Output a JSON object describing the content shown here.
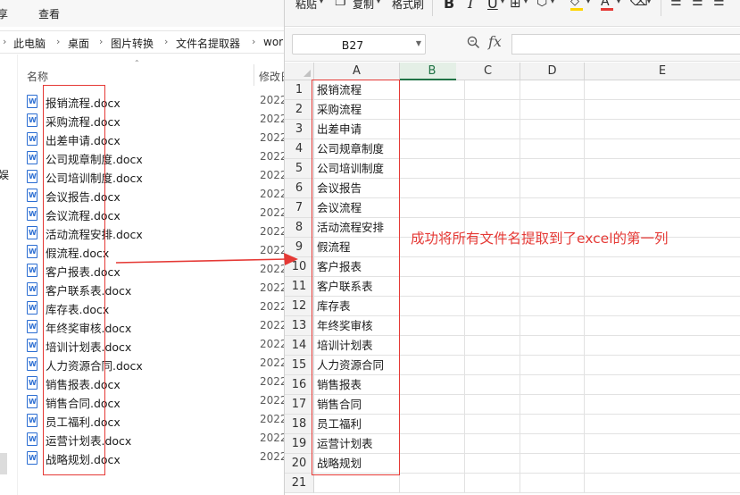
{
  "explorer": {
    "menu": [
      "享",
      "查看"
    ],
    "breadcrumb": [
      "此电脑",
      "桌面",
      "图片转换",
      "文件名提取器",
      "wor"
    ],
    "left_pane_text": "娱",
    "columns": {
      "name": "名称",
      "date": "修改日"
    },
    "files": [
      {
        "name": "报销流程.docx",
        "date": "2022"
      },
      {
        "name": "采购流程.docx",
        "date": "2022"
      },
      {
        "name": "出差申请.docx",
        "date": "2022"
      },
      {
        "name": "公司规章制度.docx",
        "date": "2022"
      },
      {
        "name": "公司培训制度.docx",
        "date": "2022"
      },
      {
        "name": "会议报告.docx",
        "date": "2022"
      },
      {
        "name": "会议流程.docx",
        "date": "2022"
      },
      {
        "name": "活动流程安排.docx",
        "date": "2022"
      },
      {
        "name": "假流程.docx",
        "date": "2022"
      },
      {
        "name": "客户报表.docx",
        "date": "2022"
      },
      {
        "name": "客户联系表.docx",
        "date": "2022"
      },
      {
        "name": "库存表.docx",
        "date": "2022"
      },
      {
        "name": "年终奖审核.docx",
        "date": "2022"
      },
      {
        "name": "培训计划表.docx",
        "date": "2022"
      },
      {
        "name": "人力资源合同.docx",
        "date": "2022"
      },
      {
        "name": "销售报表.docx",
        "date": "2022"
      },
      {
        "name": "销售合同.docx",
        "date": "2022"
      },
      {
        "name": "员工福利.docx",
        "date": "2022"
      },
      {
        "name": "运营计划表.docx",
        "date": "2022"
      },
      {
        "name": "战略规划.docx",
        "date": "2022"
      }
    ],
    "file_icon": "word-document-icon"
  },
  "ribbon": {
    "paste": "粘贴",
    "copy": "复制",
    "format_painter": "格式刷",
    "icons": [
      "copy-icon",
      "bold-icon",
      "italic-icon",
      "underline-icon",
      "borders-icon",
      "fill-color-icon",
      "font-color-icon",
      "clear-format-icon",
      "align-left-icon",
      "align-center-icon",
      "align-right-icon"
    ],
    "fill_color": "#ffd400",
    "font_color": "#e53935"
  },
  "formula_bar": {
    "name_box": "B27",
    "fx_label": "fx",
    "formula": ""
  },
  "sheet": {
    "columns": [
      "A",
      "B",
      "C",
      "D",
      "E"
    ],
    "selected_column": "B",
    "rows": [
      {
        "num": "1",
        "a": "报销流程"
      },
      {
        "num": "2",
        "a": "采购流程"
      },
      {
        "num": "3",
        "a": "出差申请"
      },
      {
        "num": "4",
        "a": "公司规章制度"
      },
      {
        "num": "5",
        "a": "公司培训制度"
      },
      {
        "num": "6",
        "a": "会议报告"
      },
      {
        "num": "7",
        "a": "会议流程"
      },
      {
        "num": "8",
        "a": "活动流程安排"
      },
      {
        "num": "9",
        "a": "假流程"
      },
      {
        "num": "10",
        "a": "客户报表"
      },
      {
        "num": "11",
        "a": "客户联系表"
      },
      {
        "num": "12",
        "a": "库存表"
      },
      {
        "num": "13",
        "a": "年终奖审核"
      },
      {
        "num": "14",
        "a": "培训计划表"
      },
      {
        "num": "15",
        "a": "人力资源合同"
      },
      {
        "num": "16",
        "a": "销售报表"
      },
      {
        "num": "17",
        "a": "销售合同"
      },
      {
        "num": "18",
        "a": "员工福利"
      },
      {
        "num": "19",
        "a": "运营计划表"
      },
      {
        "num": "20",
        "a": "战略规划"
      },
      {
        "num": "21",
        "a": ""
      }
    ]
  },
  "annotation": {
    "text": "成功将所有文件名提取到了excel的第一列",
    "color": "#e53935"
  }
}
